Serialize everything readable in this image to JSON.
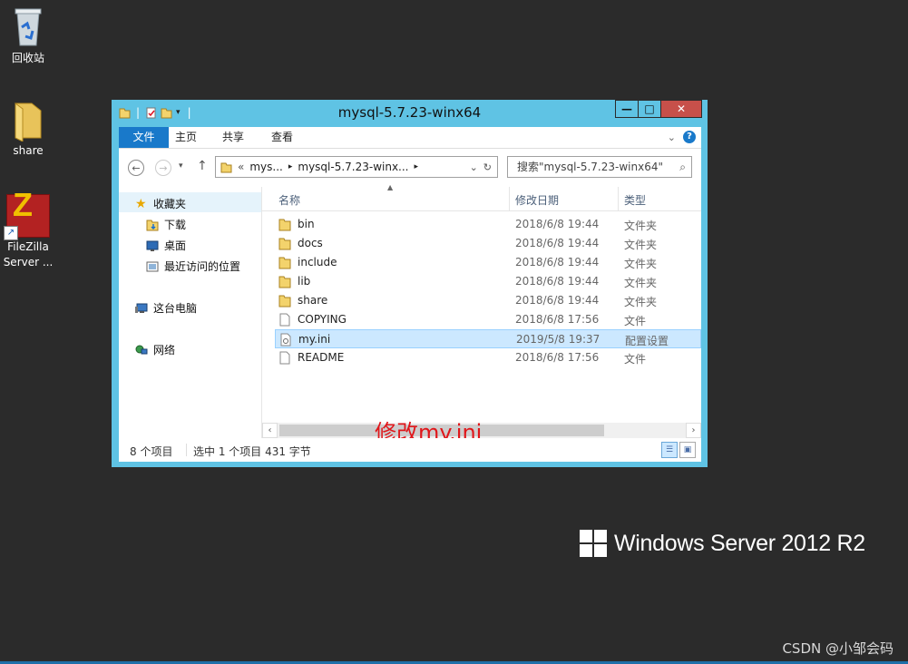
{
  "desktop": {
    "icons": [
      {
        "label": "回收站"
      },
      {
        "label": "share"
      },
      {
        "label_line1": "FileZilla",
        "label_line2": "Server ..."
      }
    ],
    "os_brand": "Windows Server 2012 R2",
    "watermark": "CSDN @小邹会码"
  },
  "window": {
    "title": "mysql-5.7.23-winx64",
    "controls": {
      "minimize": "—",
      "maximize": "□",
      "close": "✕"
    },
    "ribbon_tabs": [
      "文件",
      "主页",
      "共享",
      "查看"
    ],
    "address": {
      "prefix": "«",
      "segments": [
        "mys...",
        "mysql-5.7.23-winx..."
      ]
    },
    "search_placeholder": "搜索\"mysql-5.7.23-winx64\"",
    "nav_pane": {
      "favorites": "收藏夹",
      "downloads": "下载",
      "desktop": "桌面",
      "recent": "最近访问的位置",
      "this_pc": "这台电脑",
      "network": "网络"
    },
    "columns": {
      "name": "名称",
      "date": "修改日期",
      "type": "类型"
    },
    "files": [
      {
        "name": "bin",
        "date": "2018/6/8 19:44",
        "type": "文件夹",
        "kind": "folder"
      },
      {
        "name": "docs",
        "date": "2018/6/8 19:44",
        "type": "文件夹",
        "kind": "folder"
      },
      {
        "name": "include",
        "date": "2018/6/8 19:44",
        "type": "文件夹",
        "kind": "folder"
      },
      {
        "name": "lib",
        "date": "2018/6/8 19:44",
        "type": "文件夹",
        "kind": "folder"
      },
      {
        "name": "share",
        "date": "2018/6/8 19:44",
        "type": "文件夹",
        "kind": "folder"
      },
      {
        "name": "COPYING",
        "date": "2018/6/8 17:56",
        "type": "文件",
        "kind": "file"
      },
      {
        "name": "my.ini",
        "date": "2019/5/8 19:37",
        "type": "配置设置",
        "kind": "ini",
        "selected": true
      },
      {
        "name": "README",
        "date": "2018/6/8 17:56",
        "type": "文件",
        "kind": "file"
      }
    ],
    "annotation": "修改my.ini",
    "status": {
      "count": "8 个项目",
      "selection": "选中 1 个项目  431 字节"
    }
  },
  "colors": {
    "accent": "#1979ca",
    "titlebar": "#5fc3e4",
    "annotation": "#e0161a",
    "selection": "#cce8ff"
  }
}
